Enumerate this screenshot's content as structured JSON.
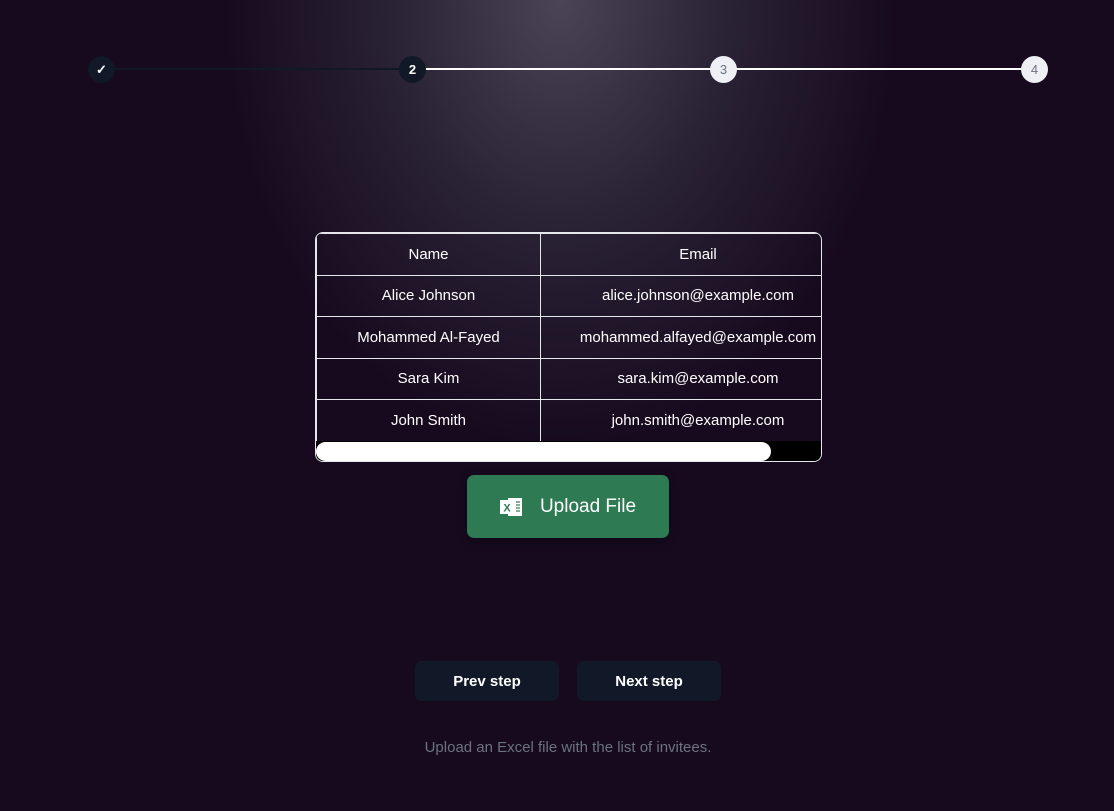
{
  "stepper": {
    "steps": [
      {
        "label": "✓",
        "state": "complete"
      },
      {
        "label": "2",
        "state": "current"
      },
      {
        "label": "3",
        "state": "upcoming"
      },
      {
        "label": "4",
        "state": "upcoming"
      }
    ]
  },
  "table": {
    "headers": [
      "Name",
      "Email"
    ],
    "rows": [
      [
        "Alice Johnson",
        "alice.johnson@example.com"
      ],
      [
        "Mohammed Al-Fayed",
        "mohammed.alfayed@example.com"
      ],
      [
        "Sara Kim",
        "sara.kim@example.com"
      ],
      [
        "John Smith",
        "john.smith@example.com"
      ]
    ]
  },
  "upload": {
    "label": "Upload File",
    "icon": "excel-icon",
    "color": "#2e7a52"
  },
  "nav": {
    "prev": "Prev step",
    "next": "Next step"
  },
  "hint": "Upload an Excel file with the list of invitees."
}
